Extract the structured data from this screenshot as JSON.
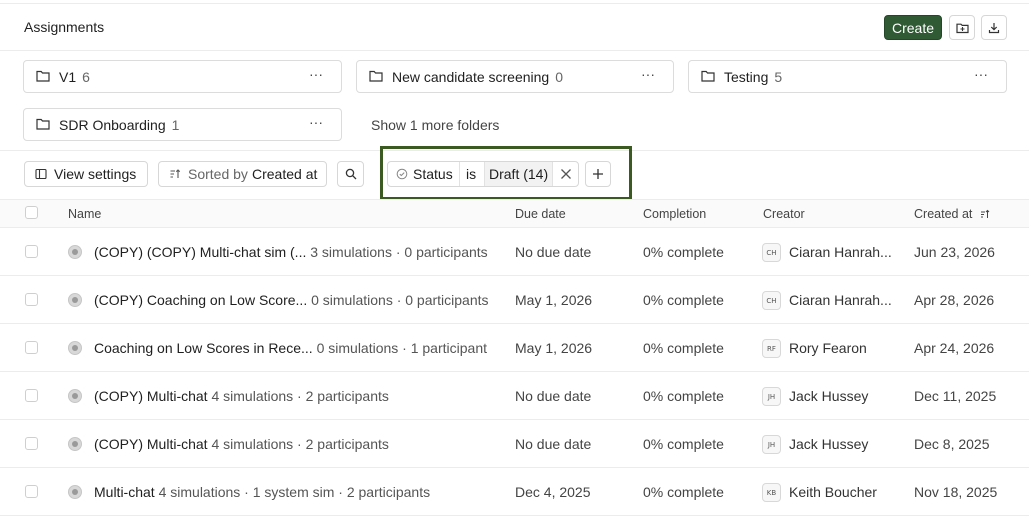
{
  "header": {
    "title": "Assignments",
    "create_label": "Create",
    "new_folder_icon": "folder-plus-icon",
    "download_icon": "download-icon"
  },
  "folders": [
    {
      "name": "V1",
      "count": "6",
      "more": "···"
    },
    {
      "name": "New candidate screening",
      "count": "0",
      "more": "···"
    },
    {
      "name": "Testing",
      "count": "5",
      "more": "···"
    },
    {
      "name": "SDR Onboarding",
      "count": "1",
      "more": "···"
    }
  ],
  "show_more_folders": "Show 1 more folders",
  "toolbar": {
    "view_settings": "View settings",
    "sorted_prefix": "Sorted by",
    "sorted_field": "Created at"
  },
  "filter": {
    "field": "Status",
    "operator": "is",
    "value": "Draft (14)"
  },
  "columns": {
    "name": "Name",
    "due_date": "Due date",
    "completion": "Completion",
    "creator": "Creator",
    "created_at": "Created at"
  },
  "rows": [
    {
      "name": "(COPY) (COPY) Multi-chat sim (...",
      "meta": "3 simulations · 0 participants",
      "due": "No due date",
      "completion": "0% complete",
      "initials": "CH",
      "creator": "Ciaran Hanrah...",
      "created": "Jun 23, 2026"
    },
    {
      "name": "(COPY) Coaching on Low Score...",
      "meta": "0 simulations · 0 participants",
      "due": "May 1, 2026",
      "completion": "0% complete",
      "initials": "CH",
      "creator": "Ciaran Hanrah...",
      "created": "Apr 28, 2026"
    },
    {
      "name": "Coaching on Low Scores in Rece...",
      "meta": "0 simulations · 1 participant",
      "due": "May 1, 2026",
      "completion": "0% complete",
      "initials": "RF",
      "creator": "Rory Fearon",
      "created": "Apr 24, 2026"
    },
    {
      "name": "(COPY) Multi-chat",
      "meta": "4 simulations · 2 participants",
      "due": "No due date",
      "completion": "0% complete",
      "initials": "JH",
      "creator": "Jack Hussey",
      "created": "Dec 11, 2025"
    },
    {
      "name": "(COPY) Multi-chat",
      "meta": "4 simulations · 2 participants",
      "due": "No due date",
      "completion": "0% complete",
      "initials": "JH",
      "creator": "Jack Hussey",
      "created": "Dec 8, 2025"
    },
    {
      "name": "Multi-chat",
      "meta": "4 simulations · 1 system sim · 2 participants",
      "due": "Dec 4, 2025",
      "completion": "0% complete",
      "initials": "KB",
      "creator": "Keith Boucher",
      "created": "Nov 18, 2025"
    }
  ]
}
